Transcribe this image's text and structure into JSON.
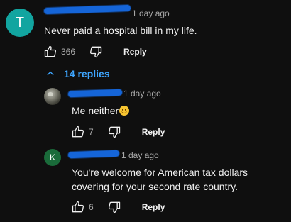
{
  "comment": {
    "avatar_letter": "T",
    "avatar_color": "#12a5a0",
    "time": "1 day ago",
    "text": "Never paid a hospital bill in my life.",
    "likes": "366",
    "reply_label": "Reply"
  },
  "replies_toggle": {
    "label": "14 replies",
    "icon": "chevron-up-icon"
  },
  "replies": [
    {
      "avatar": "profile-photo",
      "time": "1 day ago",
      "text": "Me neither",
      "emoji": "smiling-face-emoji",
      "likes": "7",
      "reply_label": "Reply"
    },
    {
      "avatar_letter": "K",
      "avatar_color": "#1a6b3a",
      "time": "1 day ago",
      "text_line1": "You're welcome for American tax dollars",
      "text_line2": "covering for your second rate country.",
      "likes": "6",
      "reply_label": "Reply"
    }
  ],
  "colors": {
    "background": "#0f0f0f",
    "redaction": "#1565d8",
    "link": "#3ea6ff",
    "secondary_text": "#aaaaaa"
  }
}
